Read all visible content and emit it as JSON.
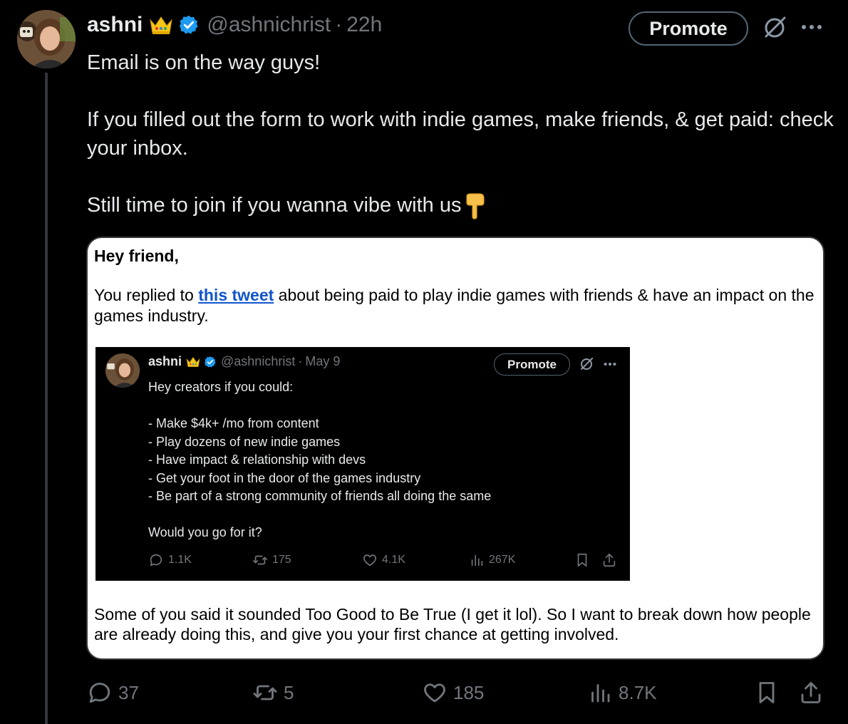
{
  "tweet": {
    "author_name": "ashni",
    "handle": "@ashnichrist",
    "separator": "·",
    "time": "22h",
    "promote_label": "Promote",
    "text": {
      "line1": "Email is on the way guys!",
      "line2": "If you filled out the form to work with indie games, make friends, & get paid: check your inbox.",
      "line3": "Still time to join if you wanna vibe with us"
    },
    "metrics": {
      "replies": "37",
      "reposts": "5",
      "likes": "185",
      "views": "8.7K"
    }
  },
  "email": {
    "greeting": "Hey friend,",
    "p1_before": "You replied to ",
    "p1_link": "this tweet",
    "p1_after": " about being paid to play indie games with friends & have an impact on the games industry.",
    "p2": "Some of you said it sounded Too Good to Be True (I get it lol). So I want to break down how people are already doing this, and give you your first chance at getting involved."
  },
  "embedded_tweet": {
    "author_name": "ashni",
    "handle": "@ashnichrist",
    "separator": "·",
    "date": "May 9",
    "promote_label": "Promote",
    "lines": {
      "intro": "Hey creators if you could:",
      "b1": "- Make $4k+ /mo from content",
      "b2": "- Play dozens of new indie games",
      "b3": "- Have impact & relationship with devs",
      "b4": "- Get your foot in the door of the games industry",
      "b5": "- Be part of a strong community of friends all doing the same",
      "question": "Would you go for it?"
    },
    "metrics": {
      "replies": "1.1K",
      "reposts": "175",
      "likes": "4.1K",
      "views": "267K"
    }
  },
  "colors": {
    "background": "#000000",
    "text": "#e7e9ea",
    "secondary": "#71767b",
    "verified": "#1d9bf0",
    "link": "#1155cc"
  },
  "icons": [
    "crown-emoji-icon",
    "verified-badge-icon",
    "no-hide-icon",
    "more-icon",
    "pointing-down-emoji-icon",
    "reply-icon",
    "repost-icon",
    "like-icon",
    "views-icon",
    "bookmark-icon",
    "share-icon"
  ]
}
